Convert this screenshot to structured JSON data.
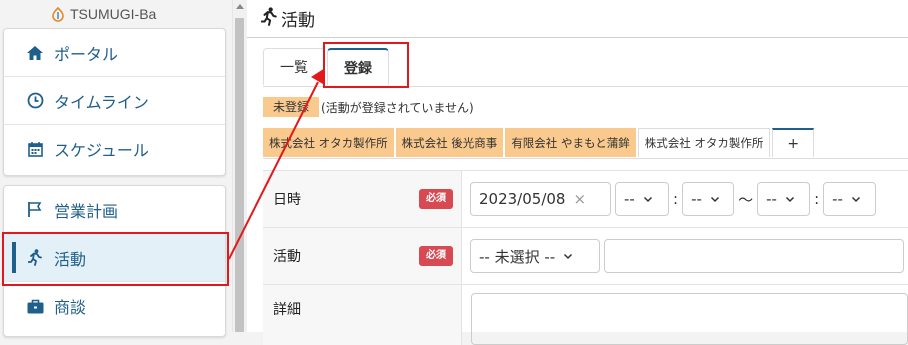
{
  "logo": {
    "text": "TSUMUGI-Ba"
  },
  "sidebar": {
    "group1": [
      {
        "label": "ポータル",
        "icon": "home-icon"
      },
      {
        "label": "タイムライン",
        "icon": "clock-icon"
      },
      {
        "label": "スケジュール",
        "icon": "calendar-icon"
      }
    ],
    "group2": [
      {
        "label": "営業計画",
        "icon": "flag-icon"
      },
      {
        "label": "活動",
        "icon": "running-icon",
        "active": true
      },
      {
        "label": "商談",
        "icon": "briefcase-icon"
      }
    ]
  },
  "header": {
    "title": "活動",
    "icon": "running-icon"
  },
  "tabs": [
    {
      "label": "一覧"
    },
    {
      "label": "登録",
      "active": true
    }
  ],
  "status": {
    "badge": "未登録",
    "message": "(活動が登録されていません)"
  },
  "subtabs": [
    {
      "label": "株式会社 オタカ製作所"
    },
    {
      "label": "株式会社 後光商事"
    },
    {
      "label": "有限会社 やまもと蒲鉾"
    },
    {
      "label": "株式会社 オタカ製作所"
    },
    {
      "label": "+"
    }
  ],
  "form": {
    "datetime": {
      "label": "日時",
      "required": "必須",
      "date": "2023/05/08",
      "clear": "×",
      "hour_start": "--",
      "colon": ":",
      "minute_start": "--",
      "tilde": "〜",
      "hour_end": "--",
      "minute_end": "--"
    },
    "activity": {
      "label": "活動",
      "required": "必須",
      "select": "-- 未選択 --"
    },
    "detail": {
      "label": "詳細"
    }
  },
  "colors": {
    "accent": "#1f5f8b",
    "badge": "#f9c98d",
    "required": "#d84a53",
    "highlight": "#e2191c",
    "active_bg": "#e3f0f8"
  }
}
